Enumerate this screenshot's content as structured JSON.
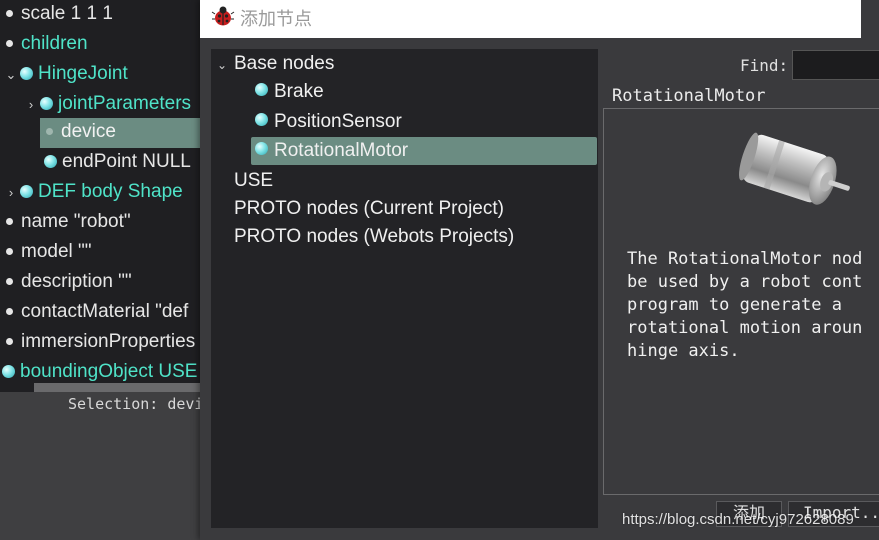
{
  "scene_tree": {
    "rows": [
      {
        "text": "scale 1 1 1"
      },
      {
        "text": "children"
      },
      {
        "text": "HingeJoint"
      },
      {
        "text": "jointParameters"
      },
      {
        "text": "device"
      },
      {
        "text": "endPoint NULL"
      },
      {
        "text": "DEF body Shape"
      },
      {
        "text": "name \"robot\""
      },
      {
        "text": "model \"\""
      },
      {
        "text": "description \"\""
      },
      {
        "text": "contactMaterial \"def"
      },
      {
        "text": "immersionProperties"
      },
      {
        "text": "boundingObject USE"
      }
    ],
    "selection_label": "Selection: devi"
  },
  "dialog": {
    "title": "添加节点",
    "node_list": {
      "base_nodes": "Base nodes",
      "brake": "Brake",
      "position_sensor": "PositionSensor",
      "rotational_motor": "RotationalMotor",
      "use": "USE",
      "proto_current": "PROTO nodes (Current Project)",
      "proto_webots": "PROTO nodes (Webots Projects)"
    },
    "find_label": "Find:",
    "find_value": "",
    "info_title": "RotationalMotor",
    "description": "The RotationalMotor nod\nbe used by a robot cont\nprogram to generate a\nrotational motion aroun\nhinge axis.",
    "add_label": "添加",
    "import_label": "Import..."
  },
  "watermark": "https://blog.csdn.net/cyj972628089",
  "colors": {
    "tree_bg": "#1f1f22",
    "dialog_bg": "#3a3a3d",
    "selection": "#6b8c82",
    "cyan_text": "#4fe3c8"
  }
}
